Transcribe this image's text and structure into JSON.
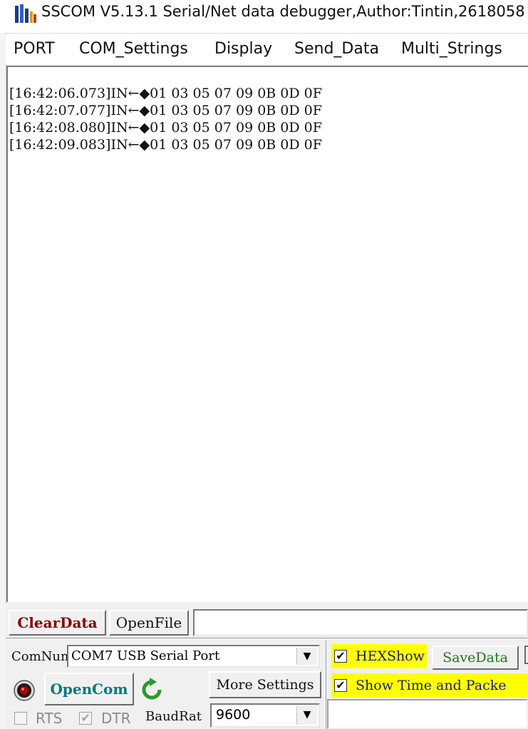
{
  "window": {
    "title": "SSCOM V5.13.1 Serial/Net data debugger,Author:Tintin,2618058"
  },
  "menu": {
    "items": [
      {
        "label": "PORT"
      },
      {
        "label": "COM_Settings"
      },
      {
        "label": "Display"
      },
      {
        "label": "Send_Data"
      },
      {
        "label": "Multi_Strings"
      }
    ]
  },
  "log": {
    "lines": [
      {
        "text": "[16:42:06.073]IN←◆01 03 05 07 09 0B 0D 0F"
      },
      {
        "text": "[16:42:07.077]IN←◆01 03 05 07 09 0B 0D 0F"
      },
      {
        "text": "[16:42:08.080]IN←◆01 03 05 07 09 0B 0D 0F"
      },
      {
        "text": "[16:42:09.083]IN←◆01 03 05 07 09 0B 0D 0F"
      }
    ]
  },
  "controls": {
    "clear_data": "ClearData",
    "open_file": "OpenFile",
    "file_path": "",
    "com_num_label": "ComNum",
    "com_port": "COM7 USB Serial Port",
    "open_com": "OpenCom",
    "more_settings": "More Settings",
    "rts_label": "RTS",
    "dtr_label": "DTR",
    "baud_label": "BaudRat",
    "baud_value": "9600",
    "hex_show": "HEXShow",
    "save_data": "SaveData",
    "show_time": "Show Time and Packe"
  },
  "colors": {
    "clear_data_text": "#8b0000",
    "open_com_text": "#007a7a",
    "save_data_text": "#1a7a1a",
    "highlight": "#ffff00",
    "refresh_icon": "#2a9a2a"
  }
}
